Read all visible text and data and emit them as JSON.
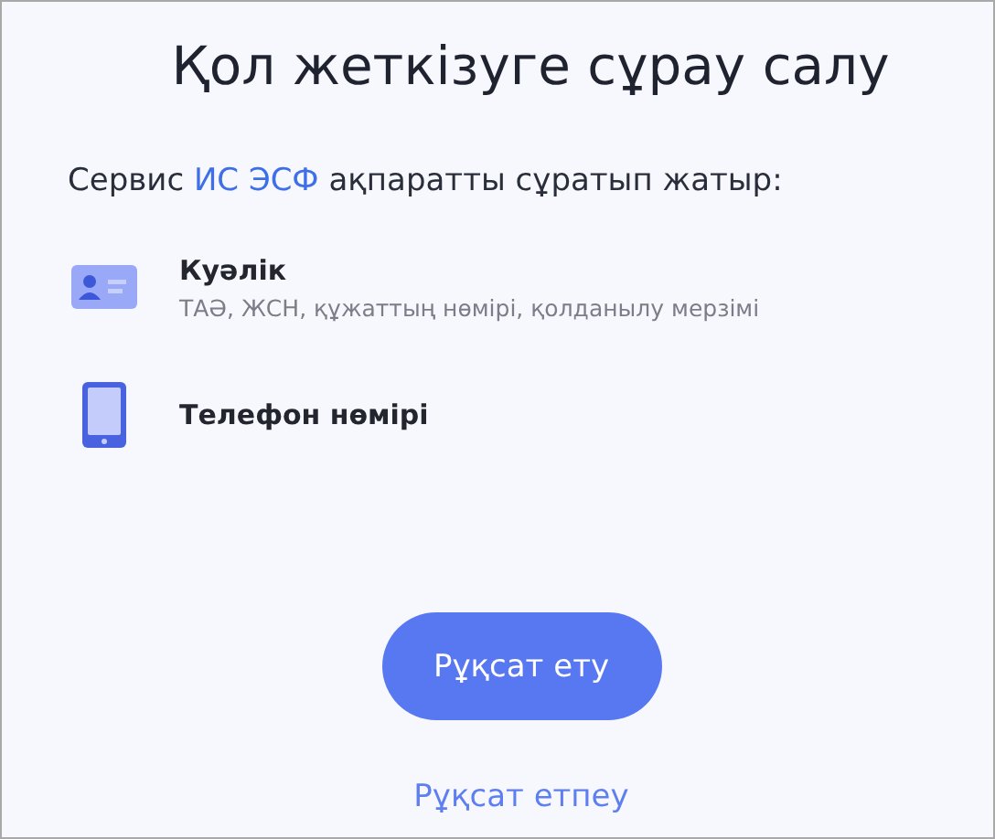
{
  "title": "Қол жеткізуге сұрау салу",
  "request": {
    "prefix": "Сервис",
    "service": "ИС ЭСФ",
    "suffix": "ақпаратты сұратып жатыр:"
  },
  "items": [
    {
      "kind": "id-card",
      "title": "Куәлік",
      "details": "ТАӘ, ЖСН, құжаттың нөмірі, қолданылу мерзімі"
    },
    {
      "kind": "phone",
      "title": "Телефон нөмірі"
    }
  ],
  "allow_button": "Рұқсат ету",
  "deny_link": "Рұқсат етпеу"
}
